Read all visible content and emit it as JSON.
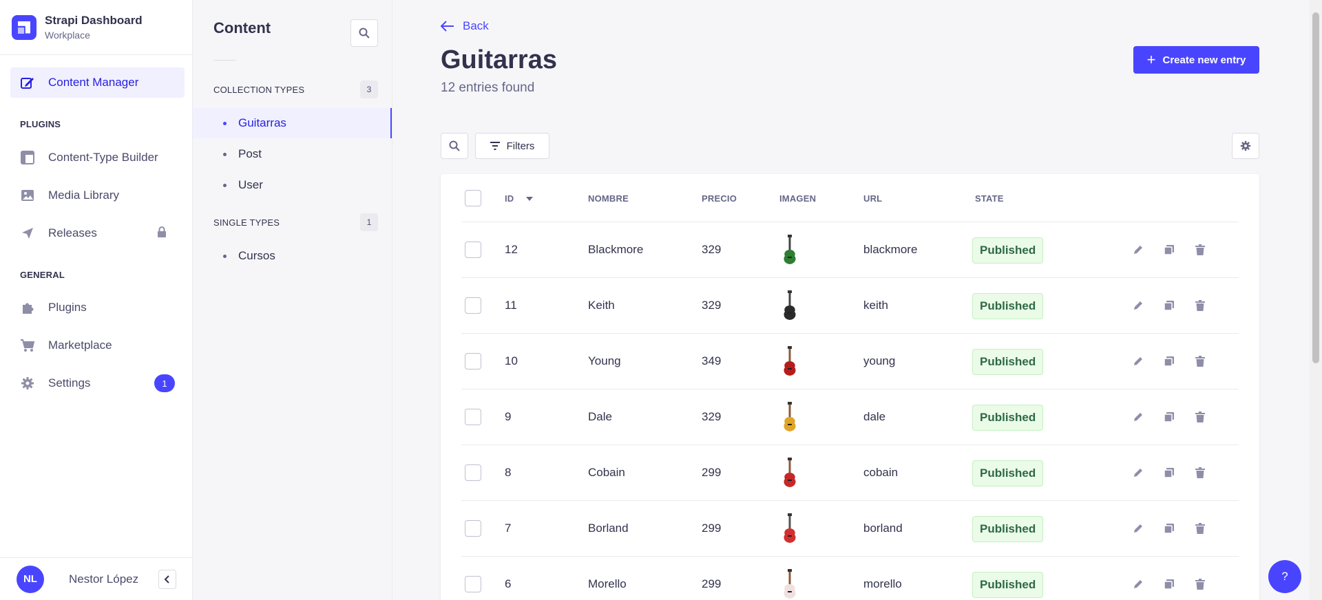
{
  "brand": {
    "title": "Strapi Dashboard",
    "subtitle": "Workplace"
  },
  "mainnav": {
    "content_manager": "Content Manager",
    "plugins_section": "PLUGINS",
    "content_type_builder": "Content-Type Builder",
    "media_library": "Media Library",
    "releases": "Releases",
    "general_section": "GENERAL",
    "plugins": "Plugins",
    "marketplace": "Marketplace",
    "settings": "Settings",
    "settings_badge": "1"
  },
  "user": {
    "initials": "NL",
    "name": "Nestor López"
  },
  "subnav": {
    "title": "Content",
    "collection_types": {
      "label": "COLLECTION TYPES",
      "count": "3",
      "items": [
        "Guitarras",
        "Post",
        "User"
      ]
    },
    "single_types": {
      "label": "SINGLE TYPES",
      "count": "1",
      "items": [
        "Cursos"
      ]
    }
  },
  "main": {
    "back": "Back",
    "title": "Guitarras",
    "subtitle": "12 entries found",
    "create_button": "Create new entry",
    "filters_button": "Filters",
    "columns": [
      "ID",
      "NOMBRE",
      "PRECIO",
      "IMAGEN",
      "URL",
      "STATE"
    ],
    "rows": [
      {
        "id": "12",
        "nombre": "Blackmore",
        "precio": "329",
        "url": "blackmore",
        "state": "Published",
        "body_color": "#2e7d32",
        "neck_color": "#444444"
      },
      {
        "id": "11",
        "nombre": "Keith",
        "precio": "329",
        "url": "keith",
        "state": "Published",
        "body_color": "#2b2b2b",
        "neck_color": "#444444"
      },
      {
        "id": "10",
        "nombre": "Young",
        "precio": "349",
        "url": "young",
        "state": "Published",
        "body_color": "#b71c1c",
        "neck_color": "#8d5a3b"
      },
      {
        "id": "9",
        "nombre": "Dale",
        "precio": "329",
        "url": "dale",
        "state": "Published",
        "body_color": "#e0a526",
        "neck_color": "#8d5a3b"
      },
      {
        "id": "8",
        "nombre": "Cobain",
        "precio": "299",
        "url": "cobain",
        "state": "Published",
        "body_color": "#c62828",
        "neck_color": "#8d5a3b"
      },
      {
        "id": "7",
        "nombre": "Borland",
        "precio": "299",
        "url": "borland",
        "state": "Published",
        "body_color": "#d32f2f",
        "neck_color": "#555555"
      },
      {
        "id": "6",
        "nombre": "Morello",
        "precio": "299",
        "url": "morello",
        "state": "Published",
        "body_color": "#f0e0e0",
        "neck_color": "#8d5a3b"
      }
    ]
  },
  "help": "?",
  "colors": {
    "primary": "#4945ff",
    "published_bg": "#eafbe7",
    "published_text": "#2f6846"
  }
}
